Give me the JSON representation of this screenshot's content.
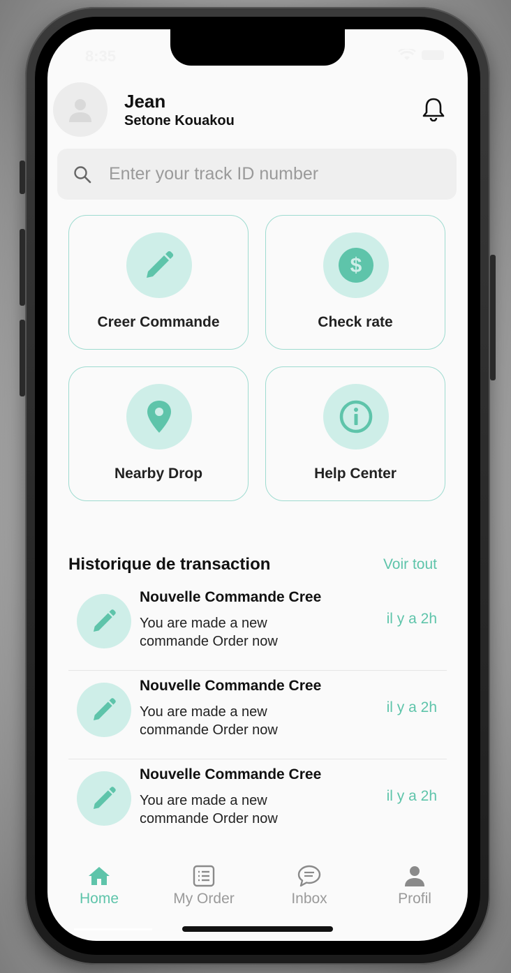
{
  "status": {
    "time": "8:35"
  },
  "user": {
    "first_name": "Jean",
    "last_name": "Setone Kouakou"
  },
  "search": {
    "placeholder": "Enter your track ID number"
  },
  "actions": [
    {
      "label": "Creer Commande",
      "icon": "pencil-icon"
    },
    {
      "label": "Check rate",
      "icon": "dollar-icon"
    },
    {
      "label": "Nearby Drop",
      "icon": "map-pin-icon"
    },
    {
      "label": "Help Center",
      "icon": "info-icon"
    }
  ],
  "history": {
    "title": "Historique de transaction",
    "see_all": "Voir tout",
    "items": [
      {
        "title": "Nouvelle Commande Cree",
        "description": "You are made a new commande Order now",
        "time": "il y a 2h",
        "icon": "pencil-icon"
      },
      {
        "title": "Nouvelle Commande Cree",
        "description": "You are made a new commande Order now",
        "time": "il y a 2h",
        "icon": "pencil-icon"
      },
      {
        "title": "Nouvelle Commande Cree",
        "description": "You are made a new commande Order now",
        "time": "il y a 2h",
        "icon": "pencil-icon"
      }
    ]
  },
  "nav": [
    {
      "label": "Home",
      "icon": "home-icon",
      "active": true
    },
    {
      "label": "My Order",
      "icon": "list-icon",
      "active": false
    },
    {
      "label": "Inbox",
      "icon": "chat-icon",
      "active": false
    },
    {
      "label": "Profil",
      "icon": "person-icon",
      "active": false
    }
  ],
  "colors": {
    "accent": "#5ec4aa",
    "accent_light": "#ceeee8",
    "card_border": "#9edbd0"
  }
}
